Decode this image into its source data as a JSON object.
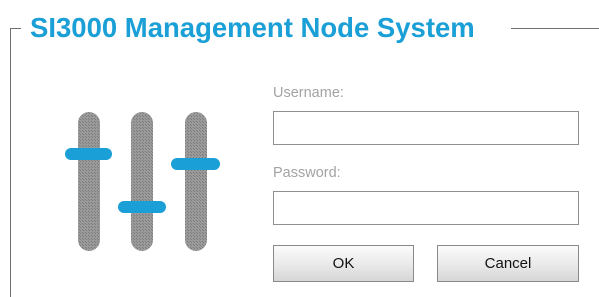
{
  "header": {
    "title": "SI3000 Management Node System"
  },
  "logo": {
    "icon": "mixer-sliders-icon",
    "accent_color": "#1a9fd6",
    "track_color": "#8c8c8c"
  },
  "login_form": {
    "username_label": "Username:",
    "username_value": "",
    "password_label": "Password:",
    "password_value": "",
    "ok_label": "OK",
    "cancel_label": "Cancel"
  },
  "colors": {
    "title": "#1a9fd6",
    "label": "#a3a3a3",
    "frame": "#6f6f6f"
  }
}
